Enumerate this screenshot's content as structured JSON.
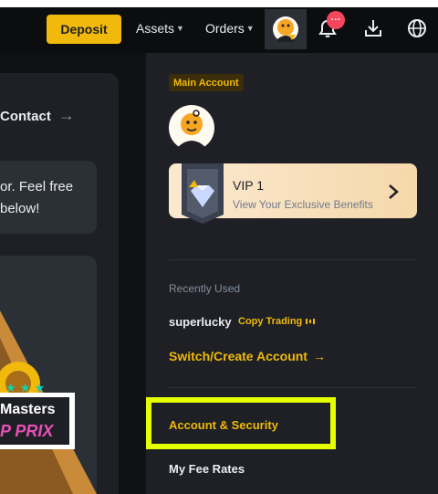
{
  "topbar": {
    "deposit_label": "Deposit",
    "assets_label": "Assets",
    "orders_label": "Orders",
    "notification_badge": "···",
    "accent_color": "#f0b90b"
  },
  "left": {
    "contact_label": "Contact",
    "info_line1": "or. Feel free",
    "info_line2": "below!",
    "promo_line1": "Masters",
    "promo_line2": "P PRIX"
  },
  "dropdown": {
    "main_badge": "Main Account",
    "vip_title": "VIP 1",
    "vip_subtitle": "View Your Exclusive Benefits",
    "recently_used_label": "Recently Used",
    "recent_account_name": "superlucky",
    "copy_trading_label": "Copy Trading",
    "switch_label": "Switch/Create Account",
    "account_security_label": "Account & Security",
    "fee_rates_label": "My Fee Rates",
    "highlight_color": "#e6ff00"
  },
  "icons": {
    "bell": "bell-icon",
    "download": "download-icon",
    "globe": "globe-icon",
    "avatar": "avatar-icon",
    "chevron": "chevron-right-icon"
  }
}
